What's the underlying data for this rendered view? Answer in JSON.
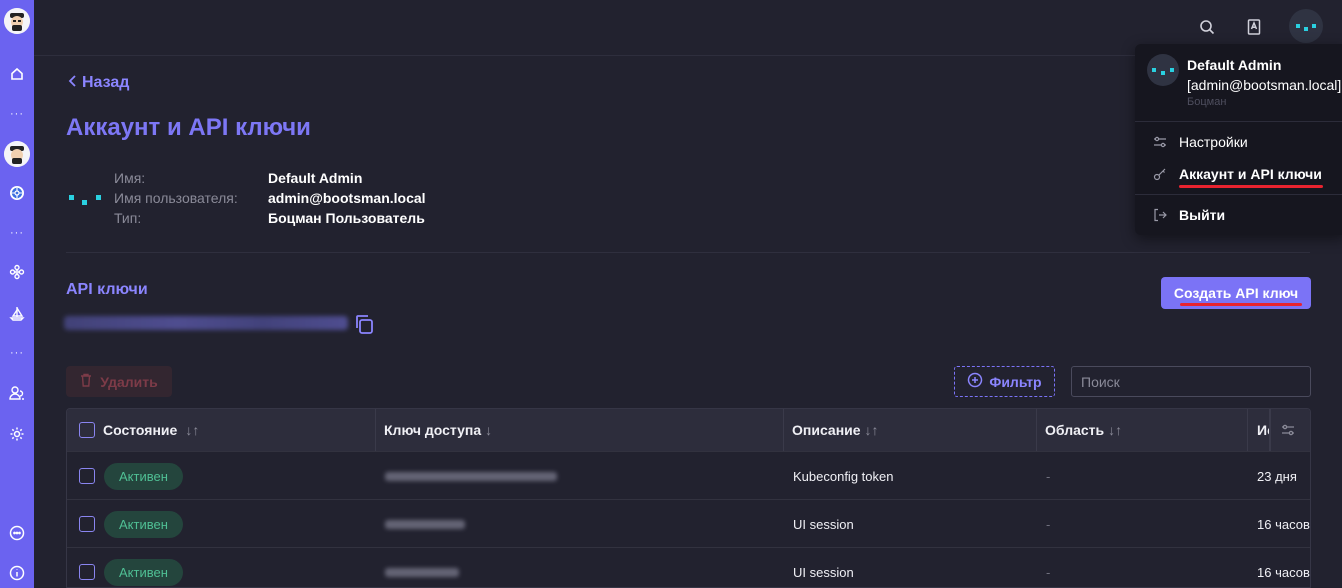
{
  "nav": {
    "back_label": "Назад"
  },
  "page": {
    "title": "Аккаунт и API ключи"
  },
  "account": {
    "rows": [
      {
        "label": "Имя:",
        "value": "Default Admin"
      },
      {
        "label": "Имя пользователя:",
        "value": "admin@bootsman.local"
      },
      {
        "label": "Тип:",
        "value": "Боцман Пользователь"
      }
    ]
  },
  "api": {
    "section_title": "API ключи",
    "create_label": "Создать API ключ",
    "delete_label": "Удалить",
    "filter_label": "Фильтр",
    "search_placeholder": "Поиск"
  },
  "table": {
    "columns": [
      {
        "label": "Состояние",
        "sort": "↓↑"
      },
      {
        "label": "Ключ доступа",
        "sort": "↓"
      },
      {
        "label": "Описание",
        "sort": "↓↑"
      },
      {
        "label": "Область",
        "sort": "↓↑"
      },
      {
        "label": "Ис",
        "sort": ""
      }
    ],
    "rows": [
      {
        "status": "Активен",
        "description": "Kubeconfig token",
        "scope": "-",
        "expires": "23 дня"
      },
      {
        "status": "Активен",
        "description": "UI session",
        "scope": "-",
        "expires": "16 часов"
      },
      {
        "status": "Активен",
        "description": "UI session",
        "scope": "-",
        "expires": "16 часов"
      }
    ]
  },
  "user_menu": {
    "name": "Default Admin",
    "email": "[admin@bootsman.local]",
    "role": "Боцман",
    "items": [
      {
        "label": "Настройки",
        "icon": "sliders-icon"
      },
      {
        "label": "Аккаунт и API ключи",
        "icon": "key-icon"
      },
      {
        "label": "Выйти",
        "icon": "logout-icon"
      }
    ]
  },
  "icons": {
    "top": [
      "search-icon",
      "docs-icon"
    ],
    "rail": [
      "home-icon",
      "cluster-icon",
      "kubernetes-icon",
      "nodes-icon",
      "sailboat-icon",
      "users-icon",
      "gear-icon",
      "chat-icon",
      "info-icon"
    ]
  },
  "colors": {
    "accent": "#7b73f6",
    "rail": "#6b63f0",
    "background": "#22222f",
    "active_badge": "#4fbf94",
    "danger": "#e8232f"
  }
}
